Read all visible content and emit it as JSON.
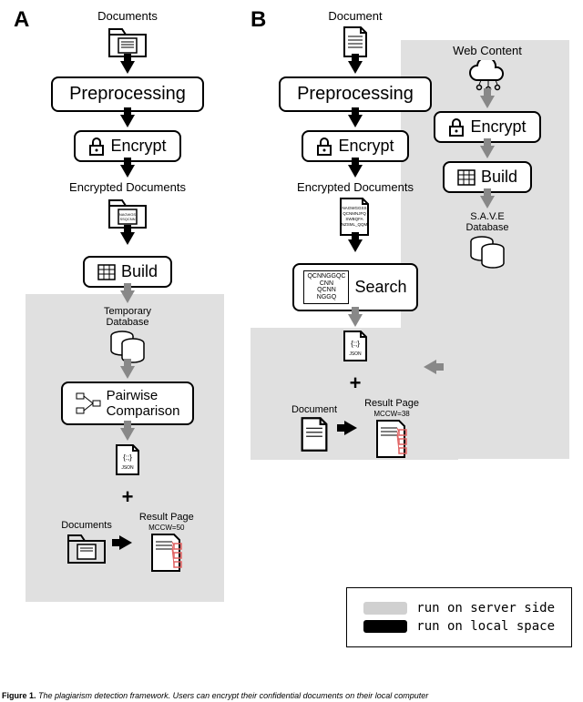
{
  "panel_a": {
    "letter": "A",
    "top_label": "Documents",
    "preprocessing": "Preprocessing",
    "encrypt": "Encrypt",
    "encrypted_label": "Encrypted Documents",
    "build": "Build",
    "temp_db": "Temporary\nDatabase",
    "pairwise": "Pairwise\nComparison",
    "json_label": "JSON",
    "plus": "+",
    "result_docs": "Documents",
    "result_page": "Result Page",
    "mccw": "MCCW=50"
  },
  "panel_b": {
    "letter": "B",
    "top_label": "Document",
    "preprocessing": "Preprocessing",
    "encrypt": "Encrypt",
    "encrypted_label": "Encrypted Documents",
    "enc_text": "NAGWGGSS\nQCNMNJFQ\nSWBQFA\nNZSML_QQM",
    "search": "Search",
    "search_side": "QCNNGGQC\nCNN\nQCNN\nNGGQ",
    "json_label": "JSON",
    "plus": "+",
    "result_doc": "Document",
    "result_page": "Result Page",
    "mccw": "MCCW=38",
    "web_content": "Web Content",
    "encrypt2": "Encrypt",
    "build": "Build",
    "save_db": "S.A.V.E\nDatabase"
  },
  "legend": {
    "server": "run on server side",
    "local": "run on local space"
  },
  "caption": {
    "fig": "Figure 1.",
    "text": "The plagiarism detection framework. Users can encrypt their confidential documents on their local computer"
  }
}
